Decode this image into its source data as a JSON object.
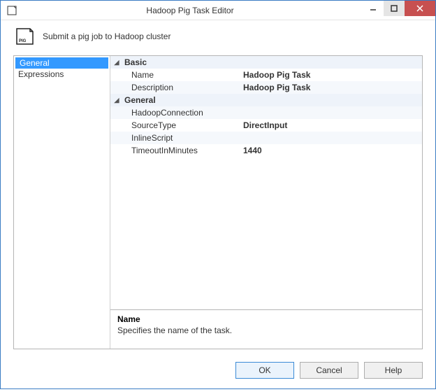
{
  "window": {
    "title": "Hadoop Pig Task Editor"
  },
  "header": {
    "subtitle": "Submit a pig job to Hadoop cluster",
    "icon_label": "PIG"
  },
  "sidebar": {
    "items": [
      {
        "label": "General",
        "selected": true
      },
      {
        "label": "Expressions",
        "selected": false
      }
    ]
  },
  "grid": {
    "categories": [
      {
        "label": "Basic",
        "properties": [
          {
            "name": "Name",
            "value": "Hadoop Pig Task",
            "bold": true
          },
          {
            "name": "Description",
            "value": "Hadoop Pig Task",
            "bold": true
          }
        ]
      },
      {
        "label": "General",
        "properties": [
          {
            "name": "HadoopConnection",
            "value": "",
            "bold": false
          },
          {
            "name": "SourceType",
            "value": "DirectInput",
            "bold": true
          },
          {
            "name": "InlineScript",
            "value": "",
            "bold": false
          },
          {
            "name": "TimeoutInMinutes",
            "value": "1440",
            "bold": true
          }
        ]
      }
    ]
  },
  "description": {
    "title": "Name",
    "text": "Specifies the name of the task."
  },
  "buttons": {
    "ok": "OK",
    "cancel": "Cancel",
    "help": "Help"
  }
}
